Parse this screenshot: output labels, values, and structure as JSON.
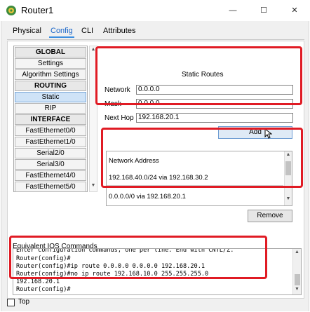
{
  "window": {
    "title": "Router1",
    "minimize_glyph": "—",
    "maximize_glyph": "☐",
    "close_glyph": "✕"
  },
  "tabs": [
    {
      "label": "Physical",
      "active": false
    },
    {
      "label": "Config",
      "active": true
    },
    {
      "label": "CLI",
      "active": false
    },
    {
      "label": "Attributes",
      "active": false
    }
  ],
  "sidebar": {
    "items": [
      {
        "label": "GLOBAL",
        "type": "header"
      },
      {
        "label": "Settings",
        "type": "item"
      },
      {
        "label": "Algorithm Settings",
        "type": "item"
      },
      {
        "label": "ROUTING",
        "type": "header"
      },
      {
        "label": "Static",
        "type": "item",
        "selected": true
      },
      {
        "label": "RIP",
        "type": "item"
      },
      {
        "label": "INTERFACE",
        "type": "header"
      },
      {
        "label": "FastEthernet0/0",
        "type": "item"
      },
      {
        "label": "FastEthernet1/0",
        "type": "item"
      },
      {
        "label": "Serial2/0",
        "type": "item"
      },
      {
        "label": "Serial3/0",
        "type": "item"
      },
      {
        "label": "FastEthernet4/0",
        "type": "item"
      },
      {
        "label": "FastEthernet5/0",
        "type": "item"
      }
    ]
  },
  "static_routes": {
    "title": "Static Routes",
    "network_label": "Network",
    "network_value": "0.0.0.0",
    "mask_label": "Mask",
    "mask_value": "0.0.0.0",
    "nexthop_label": "Next Hop",
    "nexthop_value": "192.168.20.1",
    "add_label": "Add"
  },
  "routes_list": {
    "header": "Network Address",
    "rows": [
      "192.168.40.0/24 via 192.168.30.2",
      "0.0.0.0/0 via 192.168.20.1"
    ],
    "remove_label": "Remove"
  },
  "ios": {
    "label": "Equivalent IOS Commands",
    "lines": [
      "Enter configuration commands, one per line.  End with CNTL/Z.",
      "Router(config)#",
      "Router(config)#ip route 0.0.0.0 0.0.0.0 192.168.20.1",
      "Router(config)#no ip route 192.168.10.0 255.255.255.0",
      "192.168.20.1",
      "Router(config)#"
    ]
  },
  "top_checkbox": {
    "label": "Top",
    "checked": false
  },
  "colors": {
    "highlight": "#e01b24",
    "active_tab": "#1a66c8"
  }
}
